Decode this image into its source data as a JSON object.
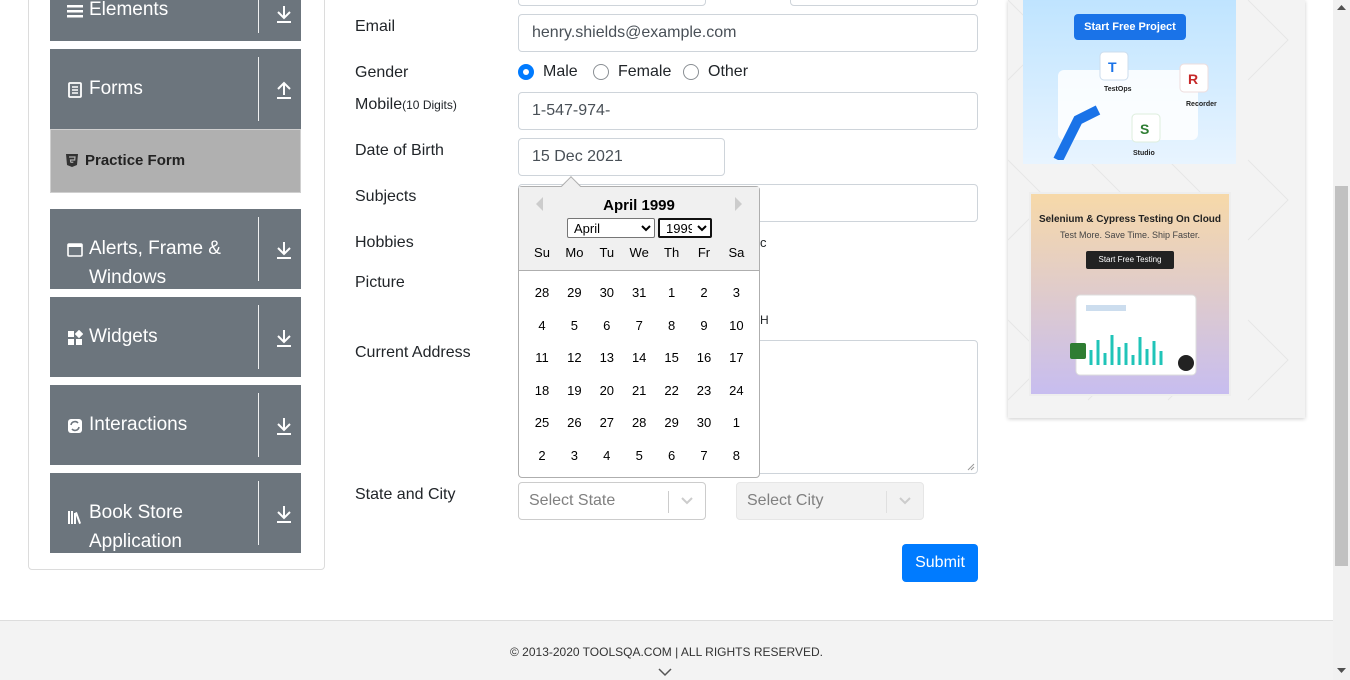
{
  "sidebar": {
    "groups": [
      {
        "label": "Elements",
        "icon": "hamburger-icon",
        "arrow": "download-arrow-icon"
      },
      {
        "label": "Forms",
        "icon": "document-icon",
        "arrow": "upload-arrow-icon"
      },
      {
        "label": "Alerts, Frame &",
        "label2": "Windows",
        "icon": "window-icon",
        "arrow": "download-arrow-icon"
      },
      {
        "label": "Widgets",
        "icon": "widgets-icon",
        "arrow": "download-arrow-icon"
      },
      {
        "label": "Interactions",
        "icon": "interactions-icon",
        "arrow": "download-arrow-icon"
      },
      {
        "label": "Book Store",
        "label2": "Application",
        "icon": "books-icon",
        "arrow": "download-arrow-icon"
      }
    ],
    "active_item": "Practice Form"
  },
  "form": {
    "email_label": "Email",
    "email_value": "henry.shields@example.com",
    "gender_label": "Gender",
    "gender_options": [
      "Male",
      "Female",
      "Other"
    ],
    "gender_selected": "Male",
    "mobile_label": "Mobile",
    "mobile_hint": "(10 Digits)",
    "mobile_value": "1-547-974-",
    "dob_label": "Date of Birth",
    "dob_value": "15 Dec 2021",
    "subjects_label": "Subjects",
    "hobbies_label": "Hobbies",
    "hobbies_partial": "c",
    "picture_label": "Picture",
    "picture_partial": "H",
    "address_label": "Current Address",
    "state_city_label": "State and City",
    "state_placeholder": "Select State",
    "city_placeholder": "Select City",
    "submit_label": "Submit"
  },
  "datepicker": {
    "title": "April 1999",
    "month_selected": "April",
    "year_selected": "1999",
    "weekdays": [
      "Su",
      "Mo",
      "Tu",
      "We",
      "Th",
      "Fr",
      "Sa"
    ],
    "weeks": [
      [
        "28",
        "29",
        "30",
        "31",
        "1",
        "2",
        "3"
      ],
      [
        "4",
        "5",
        "6",
        "7",
        "8",
        "9",
        "10"
      ],
      [
        "11",
        "12",
        "13",
        "14",
        "15",
        "16",
        "17"
      ],
      [
        "18",
        "19",
        "20",
        "21",
        "22",
        "23",
        "24"
      ],
      [
        "25",
        "26",
        "27",
        "28",
        "29",
        "30",
        "1"
      ],
      [
        "2",
        "3",
        "4",
        "5",
        "6",
        "7",
        "8"
      ]
    ]
  },
  "ads": {
    "ad1_button": "Start Free Project",
    "ad1_labels": [
      "TestOps",
      "Recorder",
      "Studio"
    ],
    "ad2_title": "Selenium & Cypress Testing On Cloud",
    "ad2_subtitle": "Test More. Save Time. Ship Faster.",
    "ad2_button": "Start Free Testing"
  },
  "footer": {
    "copyright": "© 2013-2020 TOOLSQA.COM | ALL RIGHTS RESERVED."
  },
  "colors": {
    "accent": "#007bff",
    "sidebar_group": "#6c757d",
    "sidebar_active": "#b0b0b0"
  }
}
